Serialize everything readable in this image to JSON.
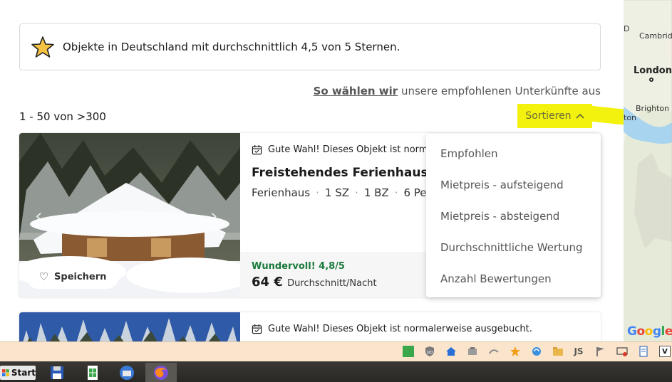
{
  "info_box": {
    "text": "Objekte in Deutschland mit durchschnittlich 4,5 von 5 Sternen.",
    "icon": "star-icon"
  },
  "how_we_choose": {
    "link": "So wählen wir",
    "rest": " unsere empfohlenen Unterkünfte aus"
  },
  "results_count": "1 - 50 von >300",
  "sort": {
    "label": "Sortieren",
    "chevron": "^",
    "options": [
      "Empfohlen",
      "Mietpreis - aufsteigend",
      "Mietpreis - absteigend",
      "Durchschnittliche Wertung",
      "Anzahl Bewertungen"
    ]
  },
  "listings": [
    {
      "note": "Gute Wahl! Dieses Objekt ist norma",
      "title": "Freistehendes Ferienhaus in",
      "facts": [
        "Ferienhaus",
        "1 SZ",
        "1 BZ",
        "6 Pe"
      ],
      "rating": "Wundervoll! 4,8/5",
      "price": "64 €",
      "price_unit": "Durchschnitt/Nacht",
      "save_label": "Speichern"
    },
    {
      "note": "Gute Wahl! Dieses Objekt ist normalerweise ausgebucht."
    }
  ],
  "map": {
    "labels": [
      "D",
      "Cambridg",
      "London",
      "Brighton",
      "ton"
    ],
    "attribution": "Google"
  },
  "taskbar": {
    "start_label": "Start"
  },
  "colors": {
    "highlight": "#f2f20e",
    "rating_green": "#1a7a3c",
    "toolbar_bg": "#fbe4cc"
  }
}
